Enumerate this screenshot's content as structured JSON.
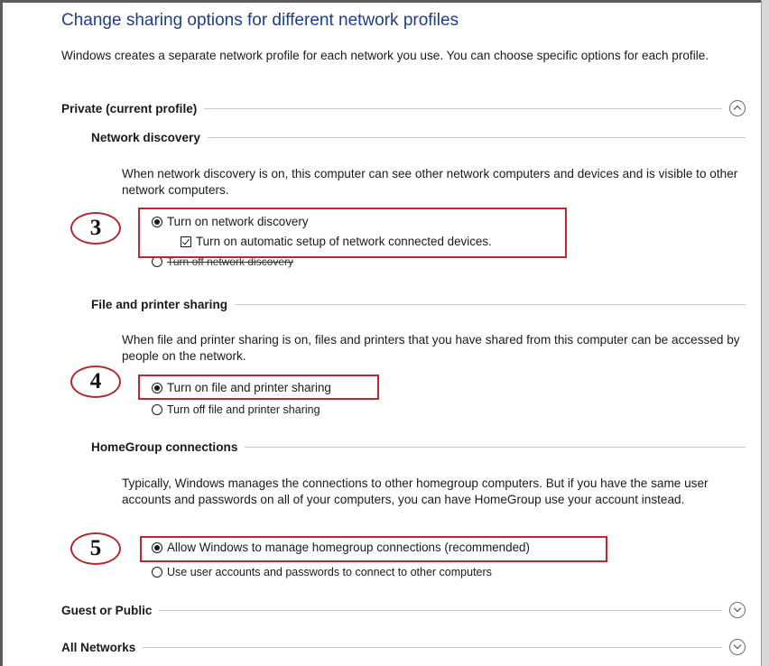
{
  "page": {
    "title": "Change sharing options for different network profiles",
    "intro": "Windows creates a separate network profile for each network you use. You can choose specific options for each profile."
  },
  "profiles": {
    "private": {
      "label": "Private (current profile)",
      "toggle_icon": "chevron-up-circle-icon"
    },
    "guest": {
      "label": "Guest or Public",
      "toggle_icon": "chevron-down-circle-icon"
    },
    "all": {
      "label": "All Networks",
      "toggle_icon": "chevron-down-circle-icon"
    }
  },
  "network_discovery": {
    "label": "Network discovery",
    "description": "When network discovery is on, this computer can see other network computers and devices and is visible to other network computers.",
    "option_on": "Turn on network discovery",
    "option_auto_setup": "Turn on automatic setup of network connected devices.",
    "option_off": "Turn off network discovery",
    "selected": "on",
    "auto_setup_checked": true
  },
  "file_printer_sharing": {
    "label": "File and printer sharing",
    "description": "When file and printer sharing is on, files and printers that you have shared from this computer can be accessed by people on the network.",
    "option_on": "Turn on file and printer sharing",
    "option_off": "Turn off file and printer sharing",
    "selected": "on"
  },
  "homegroup": {
    "label": "HomeGroup connections",
    "description": "Typically, Windows manages the connections to other homegroup computers. But if you have the same user accounts and passwords on all of your computers, you can have HomeGroup use your account instead.",
    "option_allow": "Allow Windows to manage homegroup connections (recommended)",
    "option_user": "Use user accounts and passwords to connect to other computers",
    "selected": "allow"
  },
  "callouts": [
    "3",
    "4",
    "5"
  ],
  "colors": {
    "title": "#1e3e8a",
    "highlight": "#c0262d"
  }
}
